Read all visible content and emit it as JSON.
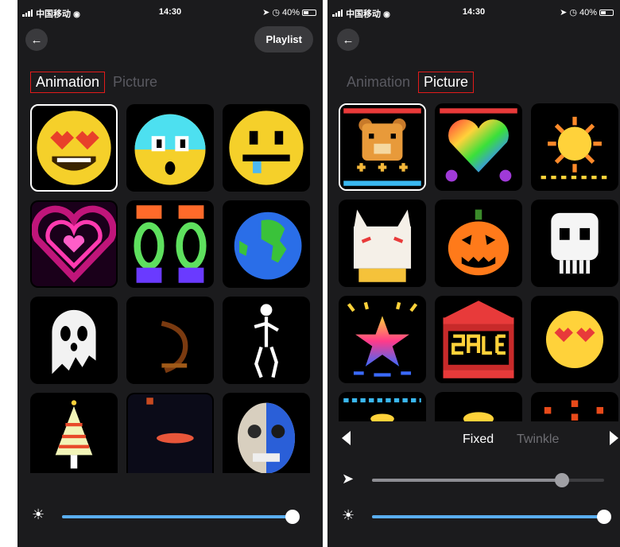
{
  "left_phone": {
    "status": {
      "carrier": "中国移动",
      "time": "14:30",
      "battery": "40%"
    },
    "playlist_label": "Playlist",
    "tabs": [
      {
        "label": "Animation",
        "active": true
      },
      {
        "label": "Picture",
        "active": false
      }
    ],
    "tiles": [
      {
        "name": "heart-eyes-emoji-tile",
        "icon": "heart-eyes-emoji"
      },
      {
        "name": "shocked-face-emoji-tile",
        "icon": "shocked-face-emoji"
      },
      {
        "name": "drooling-face-emoji-tile",
        "icon": "drooling-face-emoji"
      },
      {
        "name": "neon-heart-tile",
        "icon": "neon-heart"
      },
      {
        "name": "rainbow-chains-tile",
        "icon": "rainbow-chains"
      },
      {
        "name": "earth-globe-tile",
        "icon": "earth-globe"
      },
      {
        "name": "ghost-tile",
        "icon": "ghost"
      },
      {
        "name": "fire-swirl-tile",
        "icon": "fire-swirl"
      },
      {
        "name": "skeleton-dancer-tile",
        "icon": "skeleton"
      },
      {
        "name": "christmas-tree-tile",
        "icon": "christmas-tree"
      },
      {
        "name": "shooting-comet-tile",
        "icon": "comet"
      },
      {
        "name": "half-skull-tile",
        "icon": "skull-face"
      }
    ],
    "brightness": {
      "icon": "sun-icon",
      "level": 1.0,
      "color": "#5aaef0"
    }
  },
  "right_phone": {
    "status": {
      "carrier": "中国移动",
      "time": "14:30",
      "battery": "40%"
    },
    "tabs": [
      {
        "label": "Animation",
        "active": false
      },
      {
        "label": "Picture",
        "active": true
      }
    ],
    "tiles": [
      {
        "name": "teddy-bear-tile",
        "icon": "teddy-bear"
      },
      {
        "name": "rainbow-heart-tile",
        "icon": "rainbow-heart"
      },
      {
        "name": "sun-face-tile",
        "icon": "sun-face"
      },
      {
        "name": "fox-mask-tile",
        "icon": "fox-mask"
      },
      {
        "name": "jack-o-lantern-tile",
        "icon": "jack-o-lantern"
      },
      {
        "name": "skull-tile",
        "icon": "skull"
      },
      {
        "name": "rainbow-star-tile",
        "icon": "rainbow-star"
      },
      {
        "name": "sale-sign-tile",
        "icon": "sale-sign"
      },
      {
        "name": "heart-eyes-tile",
        "icon": "heart-eyes"
      },
      {
        "name": "sparkle-strip-tile",
        "icon": "sparkle-strip"
      },
      {
        "name": "yellow-dome-tile",
        "icon": "yellow-dome"
      },
      {
        "name": "pixel-dots-tile",
        "icon": "pixel-dots"
      }
    ],
    "modes": {
      "fixed": "Fixed",
      "twinkle": "Twinkle"
    },
    "speed": {
      "icon": "rocket-icon",
      "level": 0.82,
      "color": "#8e8e93"
    },
    "brightness": {
      "icon": "sun-icon",
      "level": 1.0,
      "color": "#5aaef0"
    }
  },
  "colors": {
    "background": "#1b1b1d",
    "accent_blue": "#5aaef0",
    "tab_highlight": "#e21b1b",
    "inactive_text": "#595960"
  }
}
